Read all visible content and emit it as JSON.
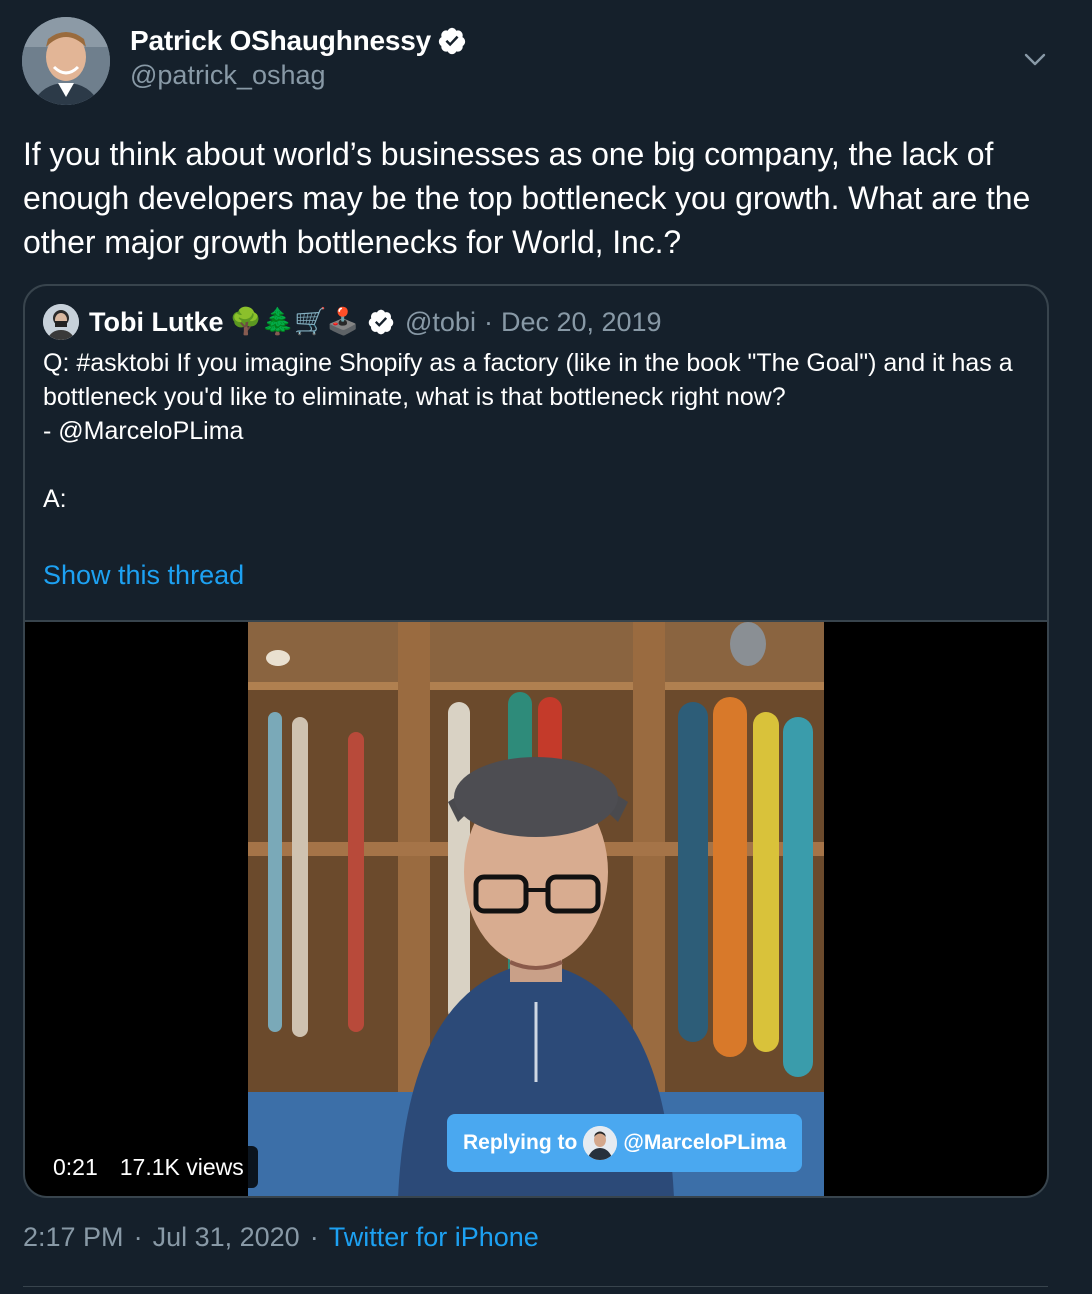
{
  "author": {
    "name": "Patrick OShaughnessy",
    "handle": "@patrick_oshag",
    "verified": true,
    "avatar_icon": "user-avatar-photo"
  },
  "tweet": {
    "text": "If you think about world’s businesses as one big company, the lack of enough developers may be the top bottleneck you growth. What are the other major growth bottlenecks for World, Inc.?"
  },
  "quoted_tweet": {
    "name": "Tobi Lutke",
    "emojis": "🌳🌲🛒🕹️",
    "verified": true,
    "handle": "@tobi",
    "separator": "·",
    "date": "Dec 20, 2019",
    "body_lines": [
      "Q: #asktobi If you imagine Shopify as a factory (like in the book \"The Goal\") and it has a bottleneck you'd like to eliminate, what is that bottleneck right now?",
      "- @MarceloPLima",
      "",
      "A:"
    ],
    "show_thread": "Show this thread",
    "video": {
      "duration": "0:21",
      "views": "17.1K views",
      "reply_prefix": "Replying to",
      "reply_handle": "@MarceloPLima"
    }
  },
  "meta": {
    "time": "2:17 PM",
    "separator": "·",
    "date": "Jul 31, 2020",
    "source": "Twitter for iPhone"
  },
  "colors": {
    "background": "#15202b",
    "text_primary": "#ffffff",
    "text_secondary": "#8899a6",
    "link": "#1da1f2",
    "border": "#38444d"
  }
}
